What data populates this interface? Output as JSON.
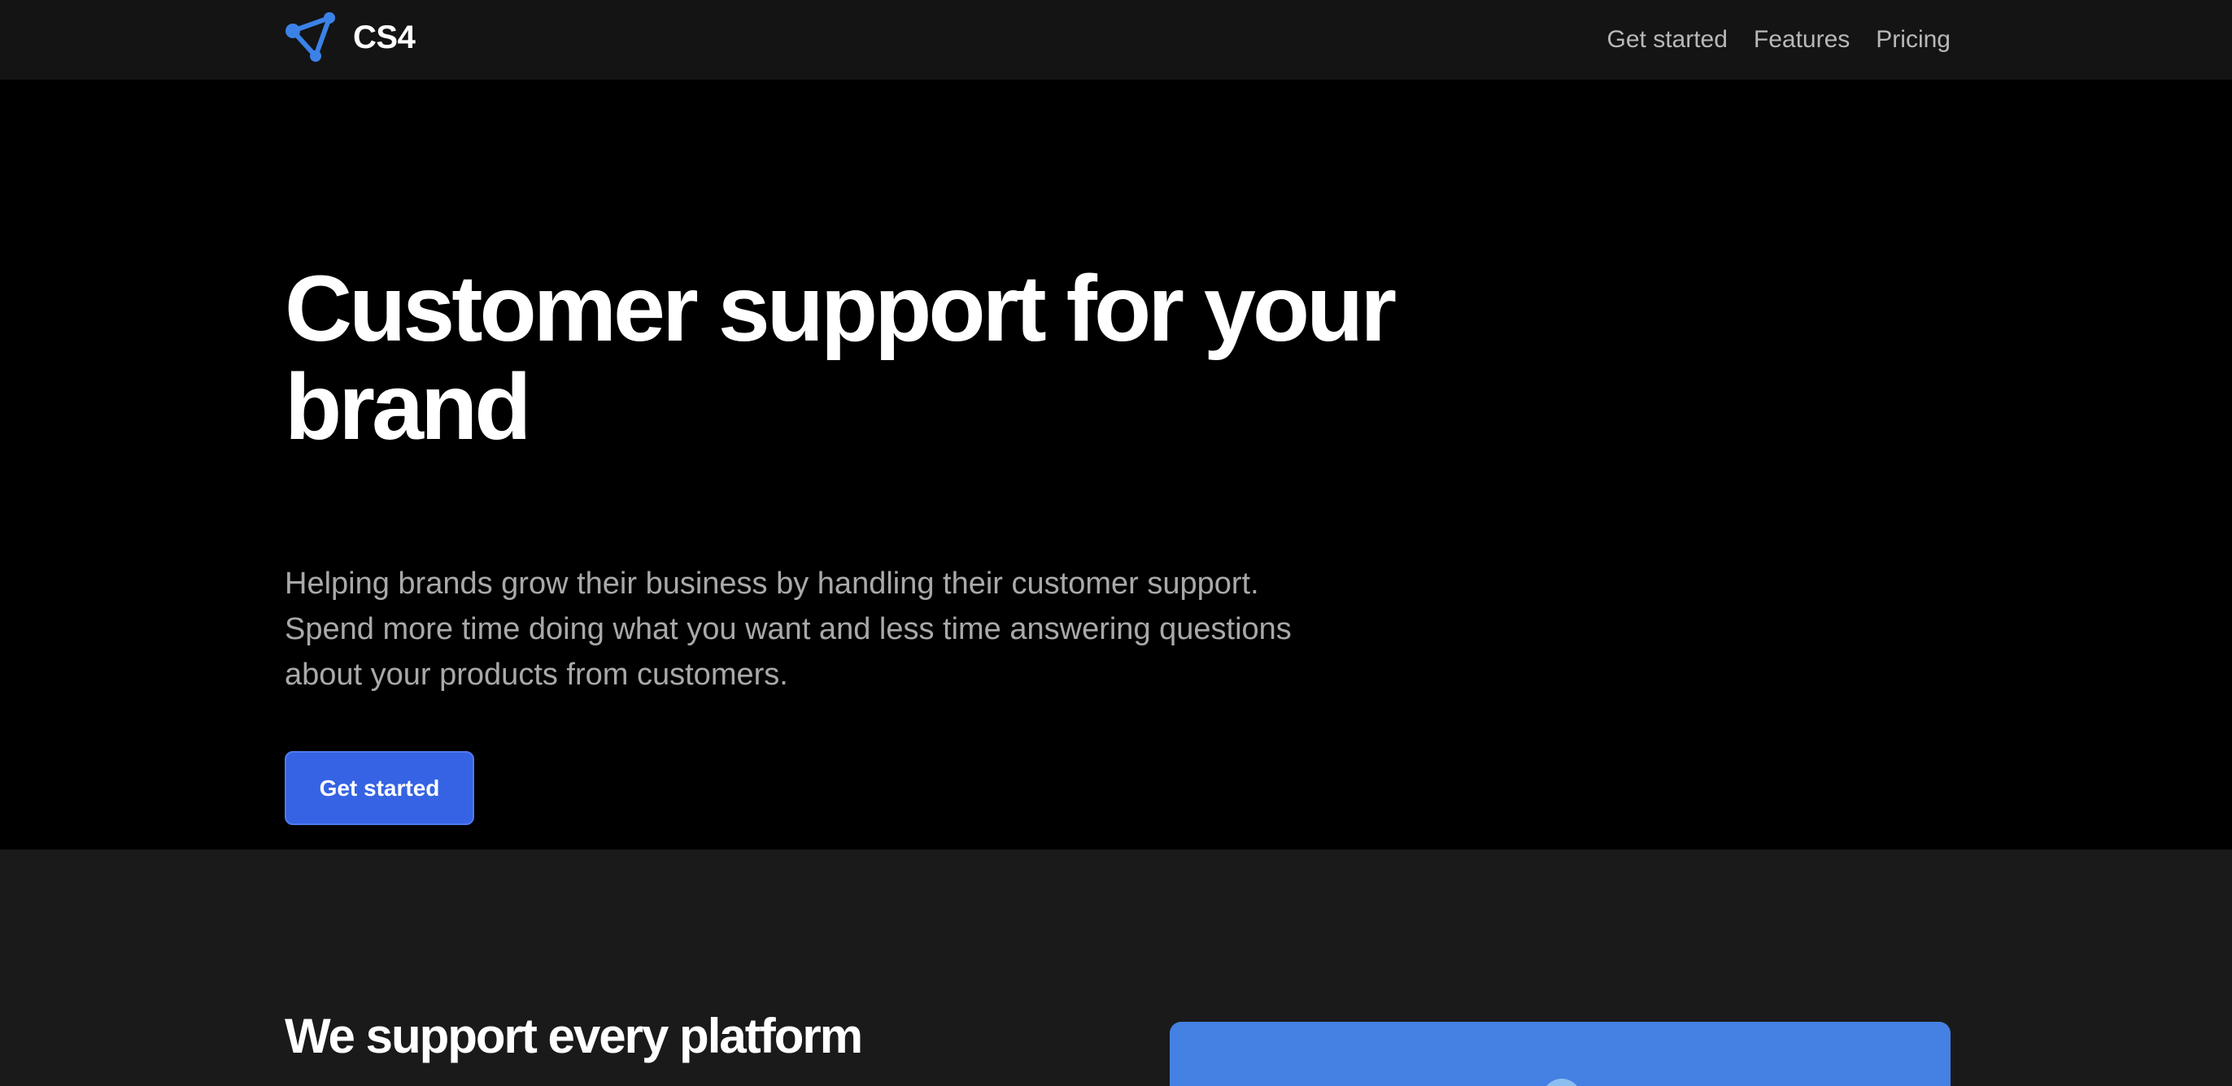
{
  "nav": {
    "logo_text": "CS4",
    "links": [
      "Get started",
      "Features",
      "Pricing"
    ]
  },
  "hero": {
    "title": "Customer support for your brand",
    "description": "Helping brands grow their business by handling their customer support. Spend more time doing what you want and less time answering questions about your products from customers.",
    "cta_label": "Get started"
  },
  "platform": {
    "title": "We support every platform"
  },
  "colors": {
    "nav_bg": "#141414",
    "hero_bg": "#000000",
    "section_bg": "#1a1a1a",
    "accent": "#3563e3",
    "logo_blue": "#3b82e8",
    "card_blue": "#4580e3"
  },
  "icons": {
    "logo": "network-triangle-icon"
  }
}
